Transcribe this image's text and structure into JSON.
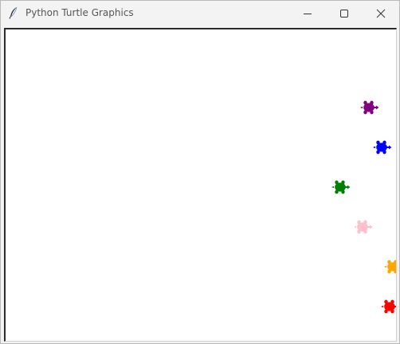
{
  "window": {
    "title": "Python Turtle Graphics",
    "icon": "feather-icon",
    "controls": [
      "minimize-icon",
      "maximize-icon",
      "close-icon"
    ]
  },
  "turtles": [
    {
      "name": "turtle-purple",
      "color": "#800080"
    },
    {
      "name": "turtle-blue",
      "color": "#0000ff"
    },
    {
      "name": "turtle-green",
      "color": "#008000"
    },
    {
      "name": "turtle-pink",
      "color": "#ffc0cb"
    },
    {
      "name": "turtle-orange",
      "color": "#ffa500"
    },
    {
      "name": "turtle-red",
      "color": "#ff0000"
    }
  ]
}
